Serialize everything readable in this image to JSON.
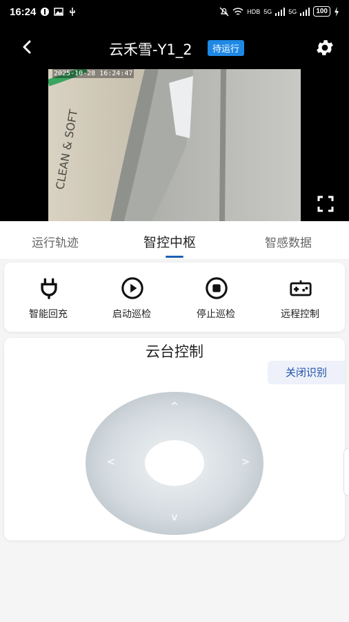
{
  "status_bar": {
    "time": "16:24",
    "network_labels": [
      "HDB",
      "5G",
      "5G"
    ],
    "battery": "100"
  },
  "header": {
    "title": "云禾雪-Y1_2",
    "status_badge": "待运行"
  },
  "video": {
    "timestamp": "2025-10-28 16:24:47"
  },
  "tabs": [
    {
      "label": "运行轨迹"
    },
    {
      "label": "智控中枢",
      "active": true
    },
    {
      "label": "智感数据"
    }
  ],
  "actions": [
    {
      "label": "智能回充",
      "icon": "plug-icon"
    },
    {
      "label": "启动巡检",
      "icon": "play-circle-icon"
    },
    {
      "label": "停止巡检",
      "icon": "stop-circle-icon"
    },
    {
      "label": "远程控制",
      "icon": "gamepad-icon"
    }
  ],
  "ptz": {
    "title": "云台控制",
    "recognition_button": "关闭识别",
    "arrows": {
      "up": "^",
      "down": "v",
      "left": "<",
      "right": ">"
    }
  },
  "colors": {
    "accent": "#1e5fb4",
    "badge": "#1e88e5",
    "header_bg": "#000000",
    "page_bg": "#f5f5f5"
  }
}
